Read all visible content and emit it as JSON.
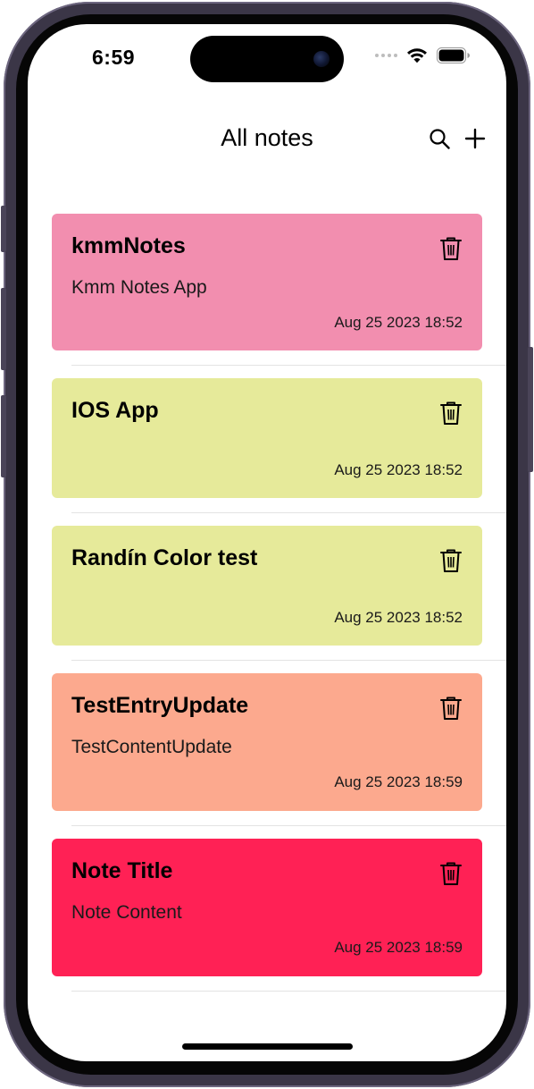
{
  "status_bar": {
    "time": "6:59"
  },
  "nav": {
    "title": "All notes",
    "search_icon": "magnifying-glass",
    "add_icon": "plus"
  },
  "notes": [
    {
      "title": "kmmNotes",
      "content": "Kmm Notes App",
      "date": "Aug 25 2023 18:52",
      "color": "#F28EAF"
    },
    {
      "title": "IOS App",
      "content": "",
      "date": "Aug 25 2023 18:52",
      "color": "#E6EA9A"
    },
    {
      "title": "Randín Color test",
      "content": "",
      "date": "Aug 25 2023 18:52",
      "color": "#E6EA9A"
    },
    {
      "title": "TestEntryUpdate",
      "content": "TestContentUpdate",
      "date": "Aug 25 2023 18:59",
      "color": "#FCA98E"
    },
    {
      "title": "Note Title",
      "content": "Note Content",
      "date": "Aug 25 2023 18:59",
      "color": "#FF2155"
    }
  ],
  "icons": {
    "delete": "trash-icon"
  }
}
